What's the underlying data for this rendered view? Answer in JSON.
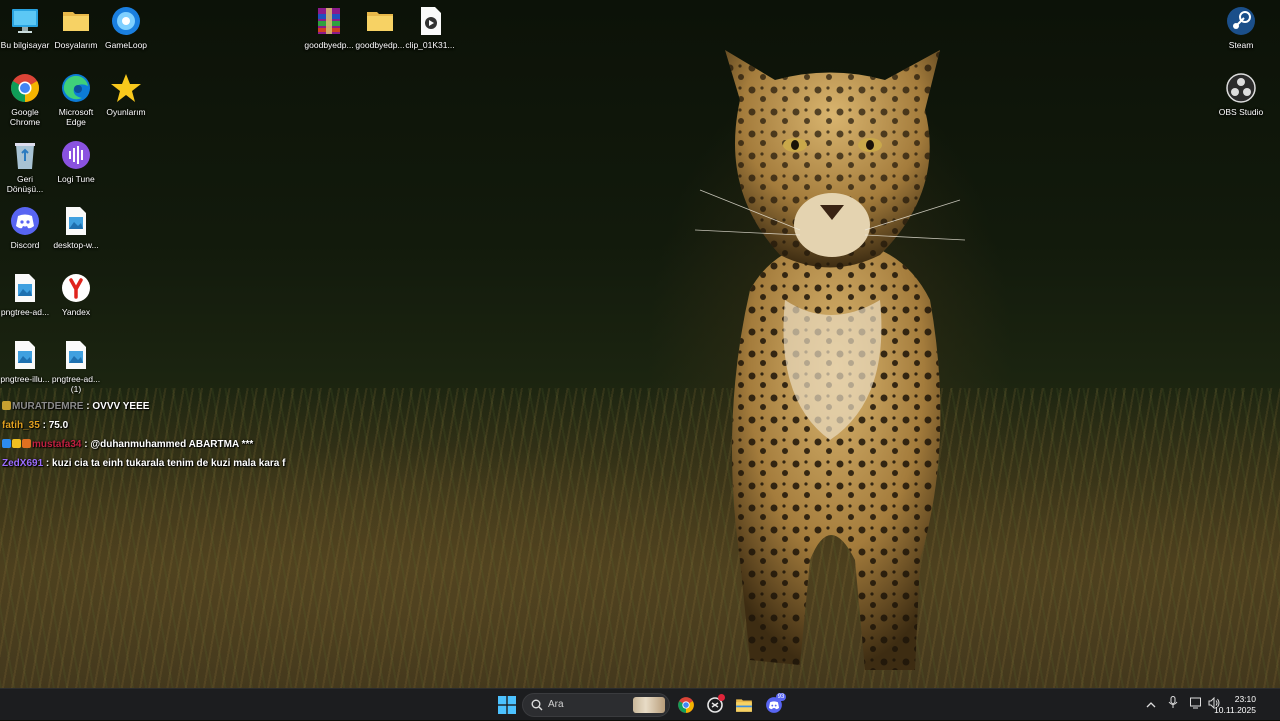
{
  "desktop_icons": [
    {
      "label": "Bu bilgisayar",
      "icon": "monitor-icon"
    },
    {
      "label": "Dosyalarım",
      "icon": "folder-icon"
    },
    {
      "label": "GameLoop",
      "icon": "gameloop-icon"
    },
    {
      "label": "goodbyedp...",
      "icon": "archive-icon"
    },
    {
      "label": "goodbyedp...",
      "icon": "folder-icon"
    },
    {
      "label": "clip_01K31...",
      "icon": "video-file-icon"
    },
    {
      "label": "Steam",
      "icon": "steam-icon"
    },
    {
      "label": "Google Chrome",
      "icon": "chrome-icon"
    },
    {
      "label": "Microsoft Edge",
      "icon": "edge-icon"
    },
    {
      "label": "Oyunlarım",
      "icon": "star-icon"
    },
    {
      "label": "OBS Studio",
      "icon": "obs-icon"
    },
    {
      "label": "Geri Dönüşü...",
      "icon": "recycle-bin-icon"
    },
    {
      "label": "Logi Tune",
      "icon": "logi-tune-icon"
    },
    {
      "label": "Discord",
      "icon": "discord-icon"
    },
    {
      "label": "desktop-w...",
      "icon": "image-file-icon"
    },
    {
      "label": "pngtree-ad...",
      "icon": "image-file-icon"
    },
    {
      "label": "Yandex",
      "icon": "yandex-icon"
    },
    {
      "label": "pngtree-illu...",
      "icon": "image-file-icon"
    },
    {
      "label": "pngtree-ad... (1)",
      "icon": "image-file-icon"
    }
  ],
  "chat": [
    {
      "user": "MURATDEMRE",
      "sep": " : ",
      "message": "OVVV YEEE",
      "user_color": "#8a8a8a"
    },
    {
      "user": "fatih_35",
      "sep": " : ",
      "message": "75.0",
      "user_color": "#e0a020"
    },
    {
      "user": "mustafa34",
      "sep": " : ",
      "message": "@duhanmuhammed ABARTMA ***",
      "user_color": "#c02040"
    },
    {
      "user": "ZedX691",
      "sep": " : ",
      "message": "kuzi cia ta einh tukarala tenim de kuzi mala kara f",
      "user_color": "#9b6cff"
    }
  ],
  "taskbar": {
    "search_placeholder": "Ara",
    "pinned": [
      {
        "name": "start-button",
        "icon": "windows-icon"
      },
      {
        "name": "chrome",
        "icon": "chrome-icon"
      },
      {
        "name": "snipping",
        "icon": "snip-icon"
      },
      {
        "name": "file-explorer",
        "icon": "folder-icon"
      },
      {
        "name": "discord",
        "icon": "discord-icon"
      }
    ],
    "discord_badge": "93",
    "tray_icons": [
      "chevron-up-icon",
      "microphone-icon",
      "display-icon",
      "speaker-icon"
    ]
  },
  "clock": {
    "time": "23:10",
    "date": "10.11.2025"
  },
  "colors": {
    "taskbar": "#1c1d1f",
    "accent": "#0078d4"
  }
}
